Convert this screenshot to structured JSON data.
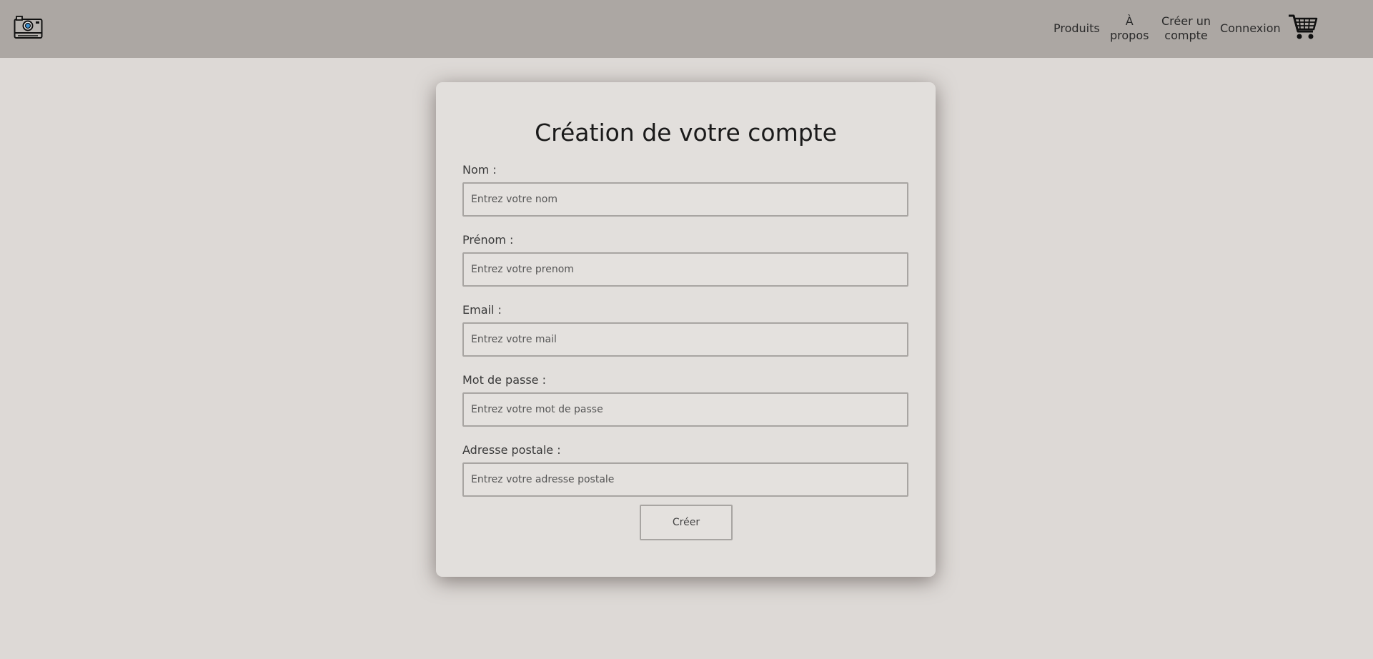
{
  "header": {
    "logo_icon": "camera-icon",
    "cart_icon": "shopping-cart-icon",
    "nav": {
      "products": "Produits",
      "about": "À\npropos",
      "signup": "Créer un\ncompte",
      "login": "Connexion"
    }
  },
  "form": {
    "title": "Création de votre compte",
    "fields": [
      {
        "label": "Nom :",
        "placeholder": "Entrez votre nom",
        "value": ""
      },
      {
        "label": "Prénom :",
        "placeholder": "Entrez votre prenom",
        "value": ""
      },
      {
        "label": "Email :",
        "placeholder": "Entrez votre mail",
        "value": ""
      },
      {
        "label": "Mot de passe :",
        "placeholder": "Entrez votre mot de passe",
        "value": ""
      },
      {
        "label": "Adresse postale :",
        "placeholder": "Entrez votre adresse postale",
        "value": ""
      }
    ],
    "submit_label": "Créer"
  },
  "colors": {
    "header_bg": "#aca7a3",
    "page_bg": "#ddd9d6",
    "card_bg": "#e2dfdc",
    "camera_lens": "#3a8fd0"
  }
}
